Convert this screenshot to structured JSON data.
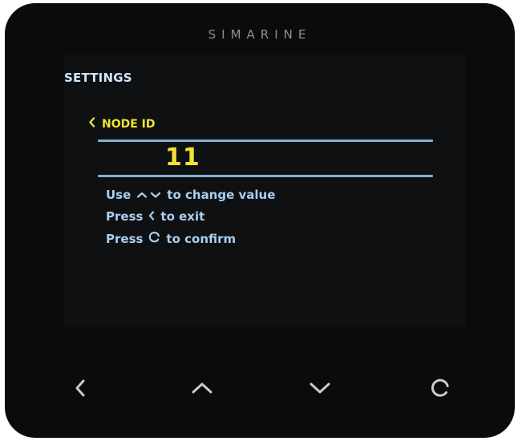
{
  "device": {
    "brand": "SIMARINE"
  },
  "screen": {
    "title": "SETTINGS",
    "field_label": "NODE ID",
    "field_value": "11",
    "hints": {
      "line1_prefix": "Use",
      "line1_suffix": "to change value",
      "line2_prefix": "Press",
      "line2_suffix": "to exit",
      "line3_prefix": "Press",
      "line3_suffix": "to confirm"
    }
  },
  "buttons": [
    {
      "name": "back",
      "icon": "chevron-left-icon"
    },
    {
      "name": "up",
      "icon": "chevron-up-icon"
    },
    {
      "name": "down",
      "icon": "chevron-down-icon"
    },
    {
      "name": "confirm",
      "icon": "circle-confirm-icon"
    }
  ],
  "colors": {
    "accent_yellow": "#f2e233",
    "text_blue": "#a9cff0",
    "title_blue": "#cfe7ff",
    "line_blue": "#7fb2d6",
    "button_gray": "#c9cbd0"
  }
}
